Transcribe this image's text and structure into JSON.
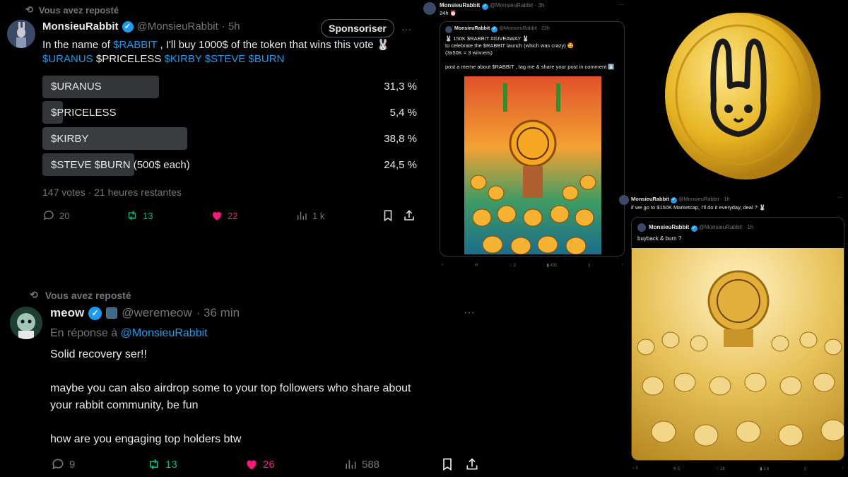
{
  "tweet1": {
    "repost_label": "Vous avez reposté",
    "name": "MonsieuRabbit",
    "handle": "@MonsieuRabbit",
    "time": "· 5h",
    "sponsor_button": "Sponsoriser",
    "text_prefix": "In the name of ",
    "text_link": "$RABBIT",
    "text_suffix": " , I'll buy 1000$ of the token that wins this vote 🐰",
    "tickers_line_a": "$URANUS",
    "tickers_line_b": "$PRICELESS",
    "tickers_line_c": "$KIRBY $STEVE $BURN",
    "poll": [
      {
        "label": "$URANUS",
        "pct": "31,3 %",
        "value": 31.3
      },
      {
        "label": "$PRICELESS",
        "pct": "5,4 %",
        "value": 5.4
      },
      {
        "label": "$KIRBY",
        "pct": "38,8 %",
        "value": 38.8
      },
      {
        "label": "$STEVE $BURN (500$ each)",
        "pct": "24,5 %",
        "value": 24.5
      }
    ],
    "poll_footer": "147 votes · 21 heures restantes",
    "actions": {
      "replies": "20",
      "reposts": "13",
      "likes": "22",
      "views": "1 k"
    }
  },
  "tweet2": {
    "repost_label": "Vous avez reposté",
    "name": "meow",
    "handle": "@weremeow",
    "time": "· 36 min",
    "reply_to_prefix": "En réponse à ",
    "reply_to_handle": "@MonsieuRabbit",
    "line1": "Solid recovery ser!!",
    "line2": "maybe you can also airdrop some to your top followers who share about",
    "line3": "your rabbit  community, be fun",
    "line4": "how are you engaging top holders btw",
    "actions": {
      "replies": "9",
      "reposts": "13",
      "likes": "26",
      "views": "588"
    }
  },
  "embed1": {
    "name": "MonsieuRabbit",
    "handle": "@MonsieuRabbit",
    "time": "· 3h",
    "text": "24h ⏰",
    "quote": {
      "name": "MonsieuRabbit",
      "handle": "@MonsieuRabbit",
      "time": "· 22h",
      "line1": "🐰 150K $RABBIT #GIVEAWAY 🐰",
      "line2": "to celebrate the $RABBIT launch (which was crazy) 🤩",
      "line3": "(3x50K = 3 winners)",
      "line4": "post a meme about $RABBIT , tag me & share your post in comment ⬇️"
    },
    "actions": {
      "likes": "2",
      "views": "431"
    }
  },
  "embed2": {
    "name": "MonsieuRabbit",
    "handle": "@MonsieuRabbit",
    "time": "· 1h",
    "text": "if we go to $150K Marketcap, I'll do it everyday, deal ? 🐰",
    "quote": {
      "name": "MonsieuRabbit",
      "handle": "@MonsieuRabbit",
      "time": "· 1h",
      "line1": "buyback & burn ?"
    },
    "actions": {
      "replies": "3",
      "reposts": "5",
      "likes": "16",
      "views": "1 k"
    }
  },
  "colors": {
    "accent": "#1d9bf0",
    "repost_green": "#00ba7c",
    "like_pink": "#f91880",
    "gold": "#e6b422"
  }
}
